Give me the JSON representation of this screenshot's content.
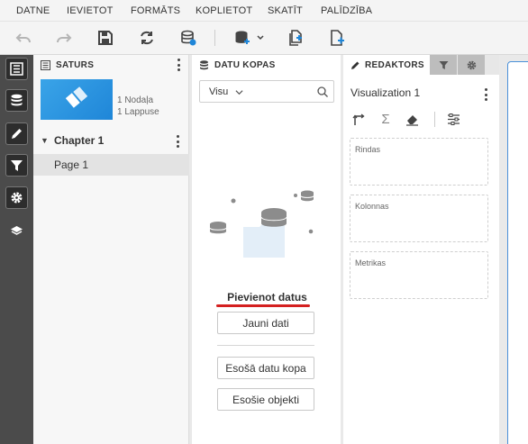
{
  "menu": [
    "DATNE",
    "IEVIETOT",
    "FORMĀTS",
    "KOPLIETOT",
    "SKATĪT",
    "PALĪDZĪBA"
  ],
  "toolbar": {
    "icons": [
      "undo-icon",
      "redo-icon",
      "save-icon",
      "refresh-icon",
      "data-source-icon",
      "add-data-dropdown-icon",
      "duplicate-page-icon",
      "new-page-icon"
    ]
  },
  "rail": {
    "icons": [
      "contents-icon",
      "database-icon",
      "pencil-icon",
      "filter-icon",
      "gear-icon",
      "layers-icon"
    ]
  },
  "contents": {
    "title": "SATURS",
    "thumb_info": [
      "1 Nodaļa",
      "1 Lappuse"
    ],
    "chapter": "Chapter 1",
    "page": "Page 1"
  },
  "datasets": {
    "title": "DATU KOPAS",
    "filter_value": "Visu",
    "add_title": "Pievienot datus",
    "new_data": "Jauni dati",
    "existing_dataset": "Esošā datu kopa",
    "existing_objects": "Esošie objekti"
  },
  "editor": {
    "tab": "REDAKTORS",
    "viz_title": "Visualization 1",
    "zones": [
      "Rindas",
      "Kolonnas",
      "Metrikas"
    ]
  },
  "colors": {
    "accent": "#1f86d8",
    "underline": "#d42020",
    "rail": "#4b4b4b"
  }
}
